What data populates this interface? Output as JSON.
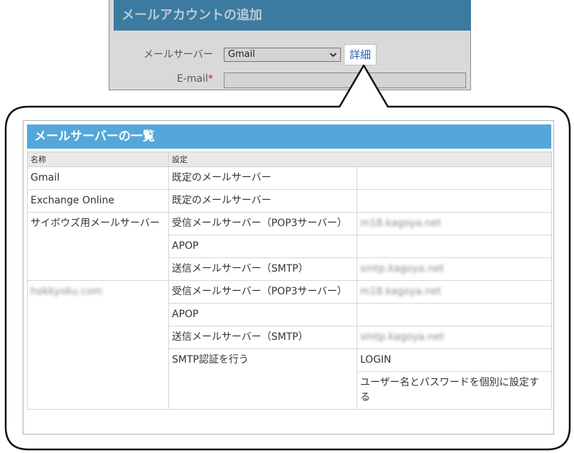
{
  "dialog": {
    "title": "メールアカウントの追加",
    "mail_server_label": "メールサーバー",
    "mail_server_value": "Gmail",
    "detail_button": "詳細",
    "email_label": "E-mail",
    "required_mark": "*"
  },
  "server_list": {
    "title": "メールサーバーの一覧",
    "headers": [
      "名称",
      "設定"
    ],
    "rows": {
      "gmail": {
        "name": "Gmail",
        "setting": "既定のメールサーバー"
      },
      "exchange": {
        "name": "Exchange Online",
        "setting": "既定のメールサーバー"
      },
      "cybozu": {
        "name": "サイボウズ用メールサーバー",
        "receive_label": "受信メールサーバー（POP3サーバー）",
        "receive_value": "m18.kagoya.net",
        "apop_label": "APOP",
        "send_label": "送信メールサーバー（SMTP）",
        "send_value": "smtp.kagoya.net"
      },
      "hokkyoku": {
        "name": "hokkyoku.com",
        "receive_label": "受信メールサーバー（POP3サーバー）",
        "receive_value": "m18.kagoya.net",
        "apop_label": "APOP",
        "send_label": "送信メールサーバー（SMTP）",
        "send_value": "smtp.kagoya.net",
        "smtp_auth_label": "SMTP認証を行う",
        "smtp_auth_value": "LOGIN",
        "smtp_auth_mode": "ユーザー名とパスワードを個別に設定する"
      }
    }
  },
  "colors": {
    "dialog_title_bg": "#3d7aa0",
    "panel_title_bg": "#54a7da",
    "link": "#1f5fae"
  }
}
